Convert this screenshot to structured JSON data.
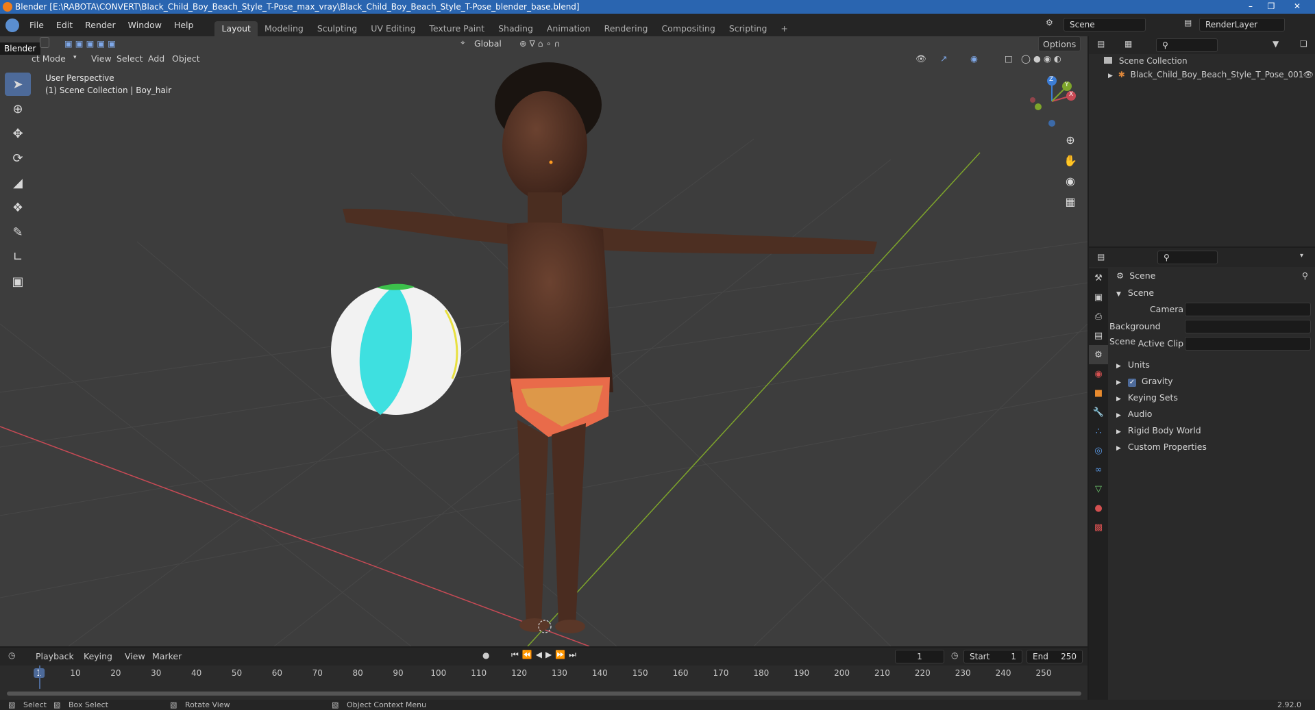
{
  "window": {
    "title": "Blender [E:\\RABOTA\\CONVERT\\Black_Child_Boy_Beach_Style_T-Pose_max_vray\\Black_Child_Boy_Beach_Style_T-Pose_blender_base.blend]",
    "tooltip": "Blender"
  },
  "menu": [
    "File",
    "Edit",
    "Render",
    "Window",
    "Help"
  ],
  "workspaces": [
    "Layout",
    "Modeling",
    "Sculpting",
    "UV Editing",
    "Texture Paint",
    "Shading",
    "Animation",
    "Rendering",
    "Compositing",
    "Scripting"
  ],
  "scene_field": "Scene",
  "renderlayer_field": "RenderLayer",
  "viewport": {
    "mode": "ct Mode",
    "menus": [
      "View",
      "Select",
      "Add",
      "Object"
    ],
    "orientation": "Global",
    "options": "Options",
    "info_line1": "User Perspective",
    "info_line2": "(1) Scene Collection | Boy_hair",
    "gizmo": {
      "x": "X",
      "y": "Y",
      "z": "Z"
    }
  },
  "outliner": {
    "collection": "Scene Collection",
    "object": "Black_Child_Boy_Beach_Style_T_Pose_001"
  },
  "properties": {
    "header": "Scene",
    "panel": "Scene",
    "camera_label": "Camera",
    "bg_scene_label": "Background Scene",
    "active_clip_label": "Active Clip",
    "subpanels": [
      "Units",
      "Gravity",
      "Keying Sets",
      "Audio",
      "Rigid Body World",
      "Custom Properties"
    ],
    "gravity_checked": true
  },
  "timeline": {
    "menus": [
      "Playback",
      "Keying",
      "View",
      "Marker"
    ],
    "current_frame": "1",
    "start_label": "Start",
    "start": "1",
    "end_label": "End",
    "end": "250",
    "ticks": [
      "1",
      "10",
      "20",
      "30",
      "40",
      "50",
      "60",
      "70",
      "80",
      "90",
      "100",
      "110",
      "120",
      "130",
      "140",
      "150",
      "160",
      "170",
      "180",
      "190",
      "200",
      "210",
      "220",
      "230",
      "240",
      "250"
    ]
  },
  "status": {
    "select": "Select",
    "box_select": "Box Select",
    "rotate_view": "Rotate View",
    "context_menu": "Object Context Menu",
    "version": "2.92.0"
  },
  "colors": {
    "accent": "#4d6a99",
    "x_axis": "#c84a55",
    "y_axis": "#7ea52b",
    "titlebar": "#2a65b0"
  }
}
